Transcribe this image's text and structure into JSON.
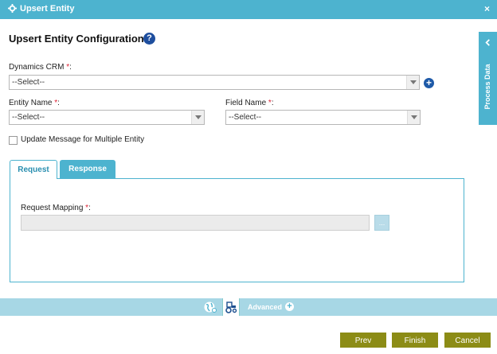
{
  "window": {
    "title": "Upsert Entity",
    "close_glyph": "×"
  },
  "header": {
    "title": "Upsert Entity Configuration",
    "help_glyph": "?"
  },
  "form": {
    "crm": {
      "label": "Dynamics CRM",
      "required": "*",
      "colon": ":",
      "value": "--Select--"
    },
    "entity": {
      "label": "Entity Name",
      "required": "*",
      "colon": ":",
      "value": "--Select--"
    },
    "field": {
      "label": "Field Name",
      "required": "*",
      "colon": ":",
      "value": "--Select--"
    },
    "multi_entity_label": "Update Message for Multiple Entity"
  },
  "tabs": {
    "request": "Request",
    "response": "Response"
  },
  "request": {
    "mapping_label": "Request Mapping",
    "required": "*",
    "colon": ":",
    "ellipsis": "..."
  },
  "side_panel": {
    "label": "Process Data"
  },
  "bottom_bar": {
    "advanced_label": "Advanced"
  },
  "footer": {
    "prev": "Prev",
    "finish": "Finish",
    "cancel": "Cancel"
  },
  "colors": {
    "accent": "#4db3cf",
    "button": "#8c8c16",
    "required": "#d23"
  },
  "icons": [
    "gear-icon",
    "close-icon",
    "help-icon",
    "add-icon",
    "chevron-left-icon",
    "globe-icon",
    "tractor-icon",
    "add-advanced-icon"
  ]
}
